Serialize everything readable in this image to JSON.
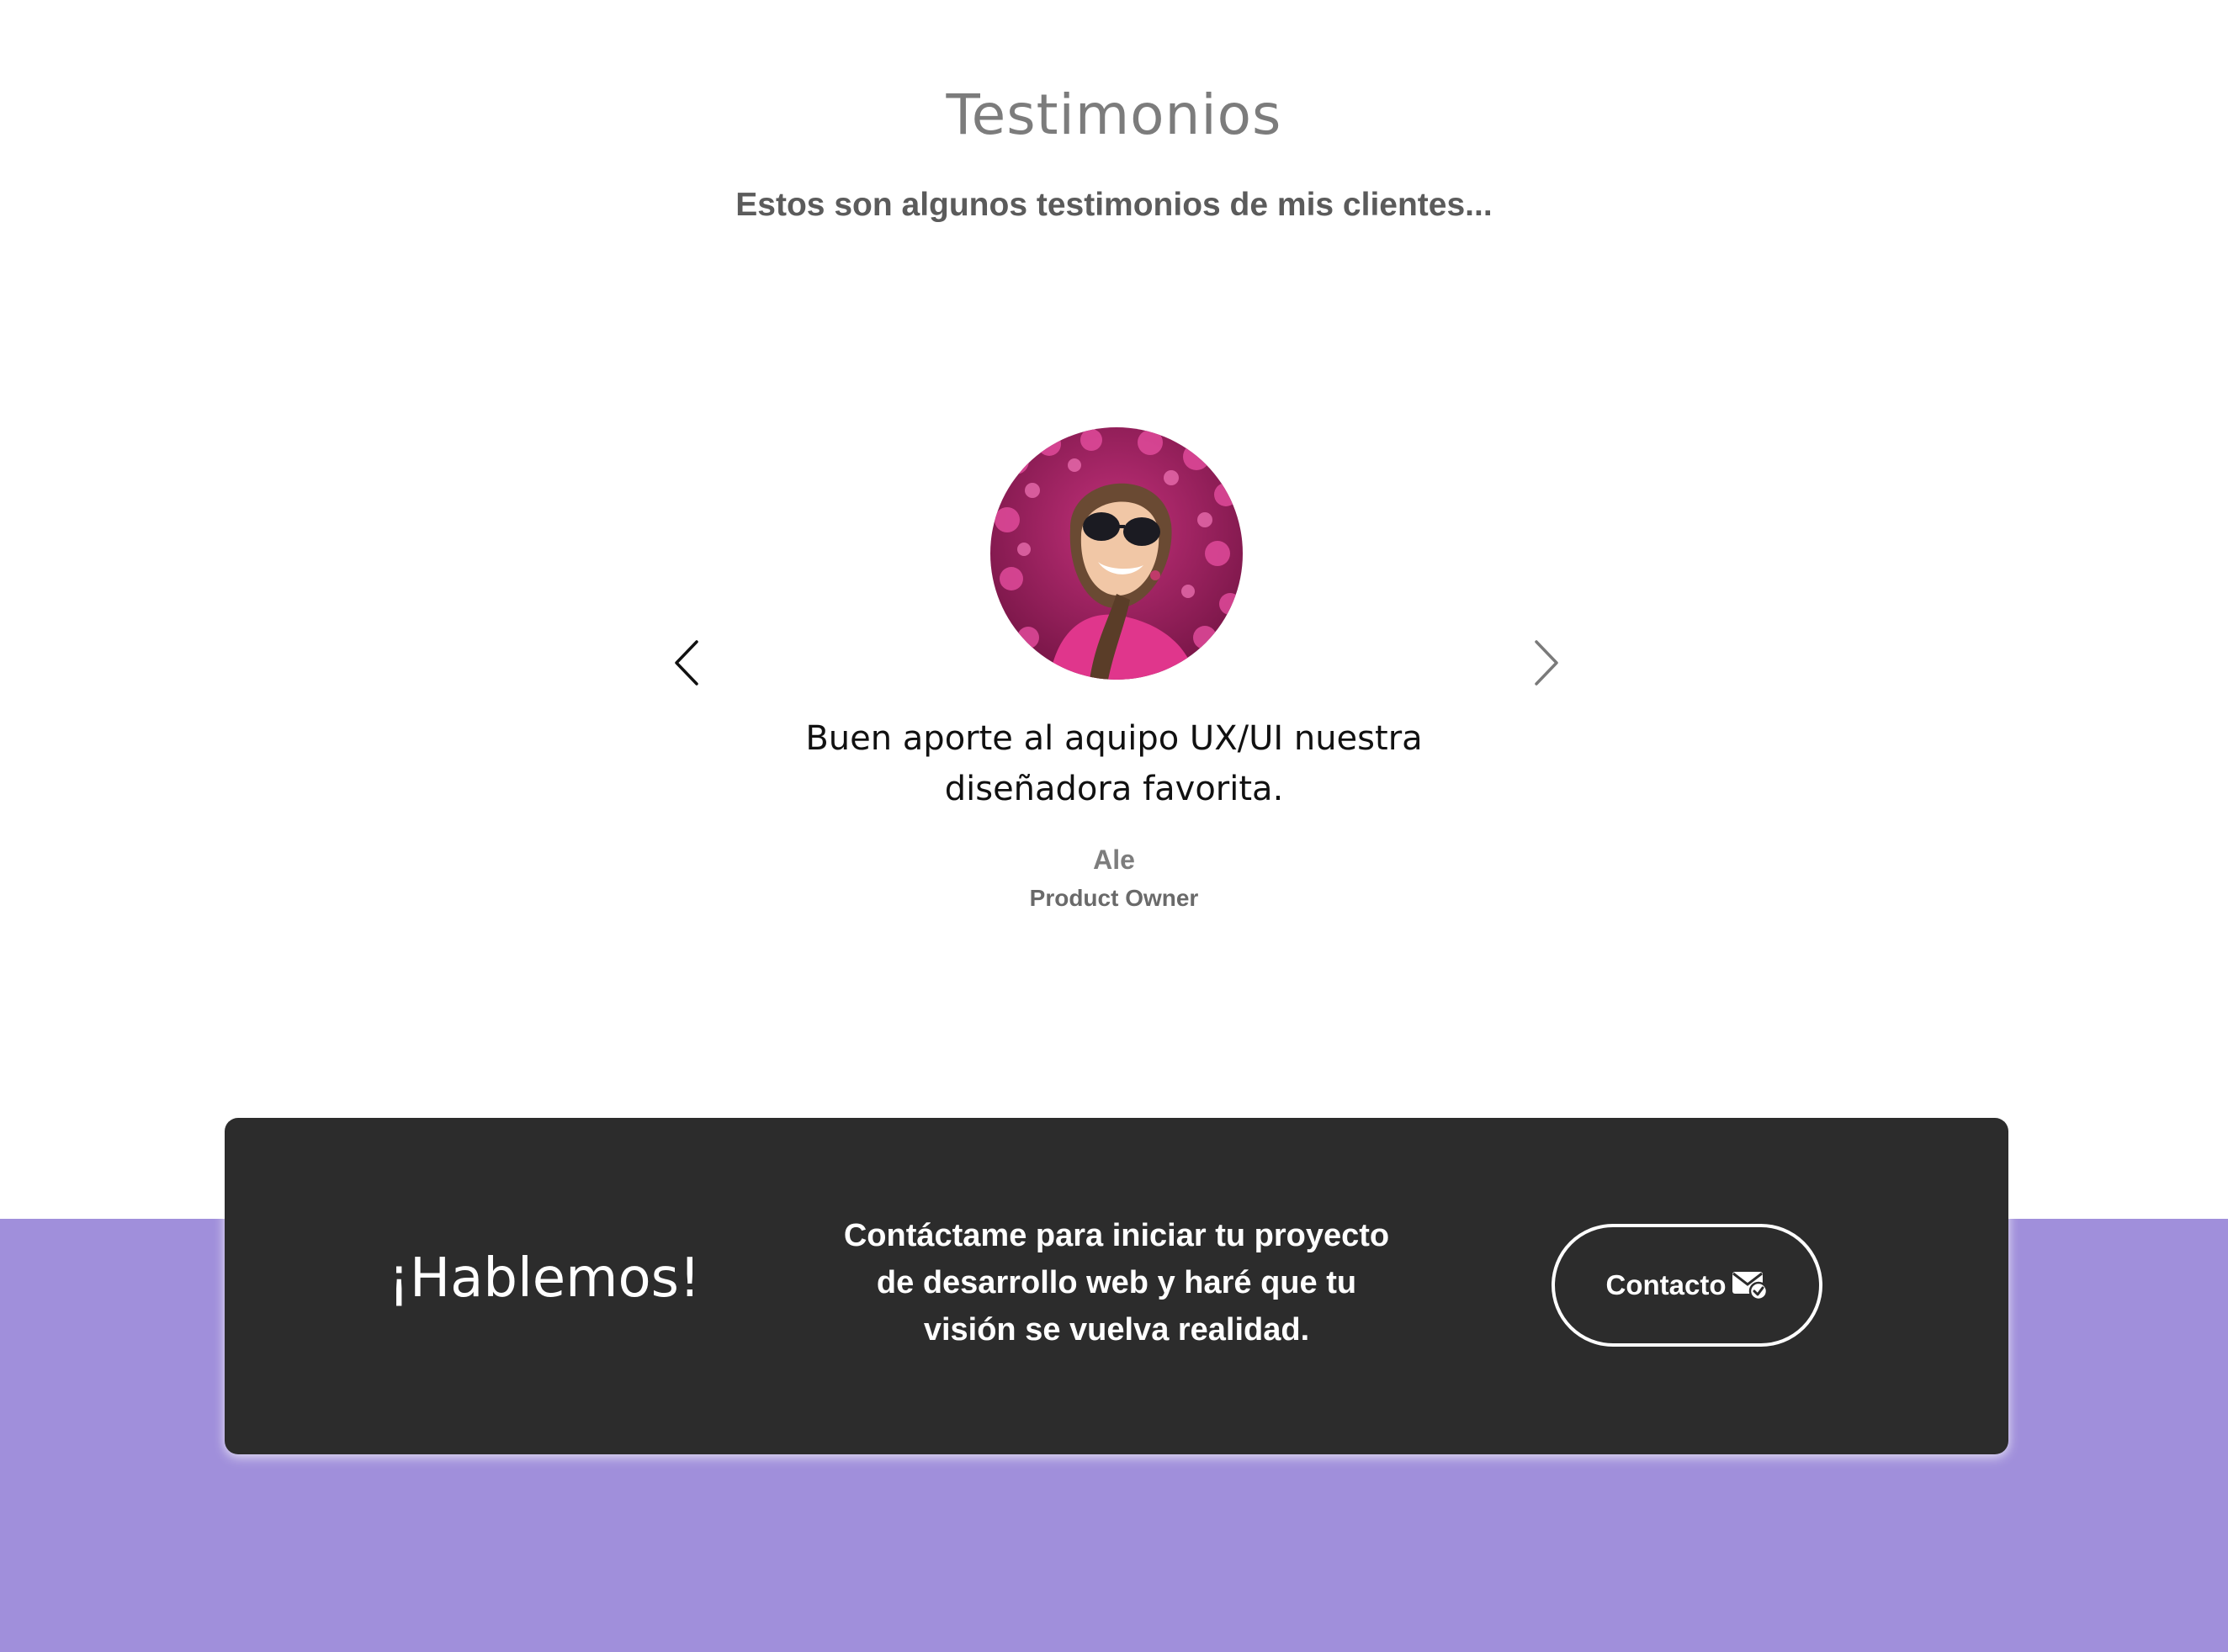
{
  "testimonials": {
    "title": "Testimonios",
    "subtitle": "Estos son algunos testimonios de mis clientes...",
    "prev_icon": "chevron-left-icon",
    "next_icon": "chevron-right-icon",
    "current": {
      "quote": "Buen aporte al aquipo UX/UI nuestra diseñadora favorita.",
      "name": "Ale",
      "role": "Product Owner"
    }
  },
  "cta": {
    "heading": "¡Hablemos!",
    "text": "Contáctame para iniciar tu proyecto de desarrollo web y haré que tu visión se vuelva realidad.",
    "button_label": "Contacto",
    "button_icon": "mail-check-icon"
  },
  "colors": {
    "band": "#a08fdb",
    "card": "#2c2c2c",
    "title": "#7c7c7c"
  }
}
